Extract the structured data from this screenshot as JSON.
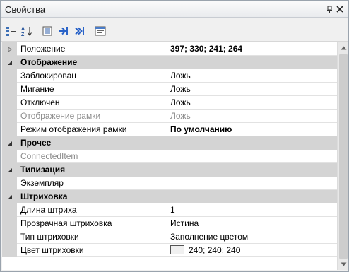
{
  "panel": {
    "title": "Свойства",
    "icons": [
      "pin-icon",
      "close-icon"
    ]
  },
  "toolbar": {
    "buttons": [
      "categorized-icon",
      "alphabetical-sort-icon",
      "properties-icon",
      "go-to-icon",
      "go-to-all-icon",
      "events-icon"
    ]
  },
  "grid": {
    "top_row": {
      "name": "Положение",
      "value": "397; 330; 241; 264"
    },
    "categories": [
      {
        "name": "Отображение",
        "rows": [
          {
            "name": "Заблокирован",
            "value": "Ложь"
          },
          {
            "name": "Мигание",
            "value": "Ложь"
          },
          {
            "name": "Отключен",
            "value": "Ложь"
          },
          {
            "name": "Отображение рамки",
            "value": "Ложь",
            "disabled": true
          },
          {
            "name": "Режим отображения рамки",
            "value": "По умолчанию",
            "bold_value": true
          }
        ]
      },
      {
        "name": "Прочее",
        "rows": [
          {
            "name": "ConnectedItem",
            "value": "",
            "disabled": true
          }
        ]
      },
      {
        "name": "Типизация",
        "rows": [
          {
            "name": "Экземпляр",
            "value": ""
          }
        ]
      },
      {
        "name": "Штриховка",
        "rows": [
          {
            "name": "Длина штриха",
            "value": "1"
          },
          {
            "name": "Прозрачная штриховка",
            "value": "Истина"
          },
          {
            "name": "Тип штриховки",
            "value": "Заполнение цветом"
          },
          {
            "name": "Цвет штриховки",
            "value": "240; 240; 240",
            "swatch_color": "#f0f0f0"
          }
        ]
      }
    ]
  },
  "colors": {
    "category_band": "#d4d4d4",
    "disabled_text": "#8a8a8a"
  }
}
